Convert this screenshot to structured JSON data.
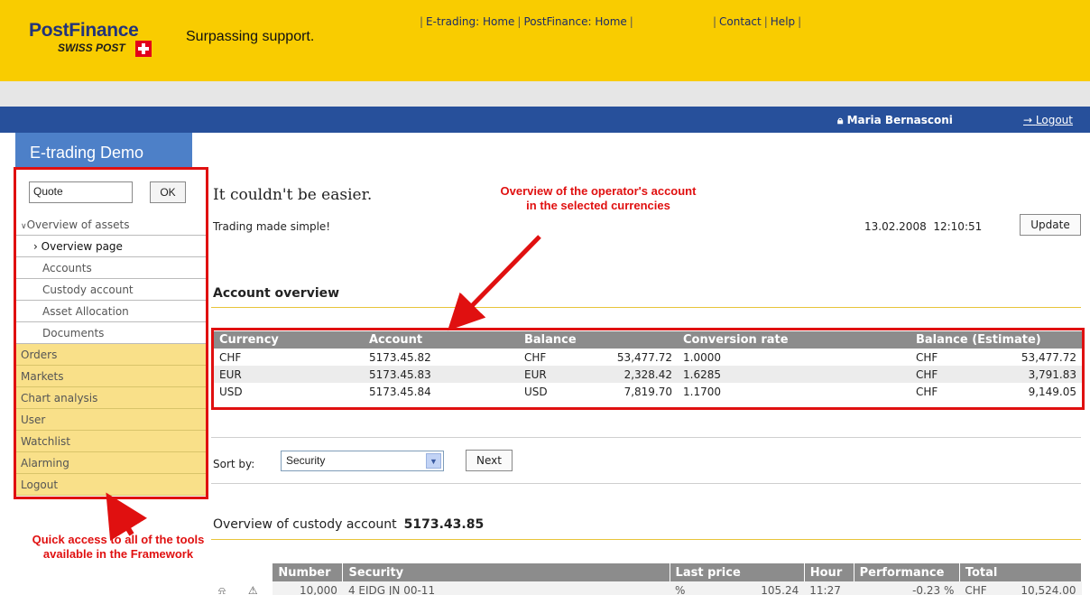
{
  "header": {
    "brand": "PostFinance",
    "brand_sub": "SWISS POST",
    "tagline": "Surpassing support.",
    "links": [
      "E-trading: Home",
      "PostFinance: Home",
      "Contact",
      "Help"
    ]
  },
  "userbar": {
    "user": "Maria Bernasconi",
    "logout": "Logout"
  },
  "sidebar": {
    "title": "E-trading Demo",
    "quote_value": "Quote",
    "ok_label": "OK",
    "items": [
      {
        "label": "Overview of assets"
      },
      {
        "label": "Overview page"
      },
      {
        "label": "Accounts"
      },
      {
        "label": "Custody account"
      },
      {
        "label": "Asset Allocation"
      },
      {
        "label": "Documents"
      },
      {
        "label": "Orders"
      },
      {
        "label": "Markets"
      },
      {
        "label": "Chart analysis"
      },
      {
        "label": "User"
      },
      {
        "label": "Watchlist"
      },
      {
        "label": "Alarming"
      },
      {
        "label": "Logout"
      }
    ]
  },
  "main": {
    "headline": "It couldn't be easier.",
    "subline": "Trading made simple!",
    "date": "13.02.2008",
    "time": "12:10:51",
    "update_label": "Update",
    "account_overview_title": "Account overview",
    "account_table": {
      "headers": [
        "Currency",
        "Account",
        "Balance",
        "Conversion rate",
        "Balance (Estimate)"
      ],
      "rows": [
        {
          "currency": "CHF",
          "account": "5173.45.82",
          "bal_cur": "CHF",
          "balance": "53,477.72",
          "rate": "1.0000",
          "est_cur": "CHF",
          "estimate": "53,477.72"
        },
        {
          "currency": "EUR",
          "account": "5173.45.83",
          "bal_cur": "EUR",
          "balance": "2,328.42",
          "rate": "1.6285",
          "est_cur": "CHF",
          "estimate": "3,791.83"
        },
        {
          "currency": "USD",
          "account": "5173.45.84",
          "bal_cur": "USD",
          "balance": "7,819.70",
          "rate": "1.1700",
          "est_cur": "CHF",
          "estimate": "9,149.05"
        }
      ]
    },
    "sort_label": "Sort by:",
    "sort_value": "Security",
    "next_label": "Next",
    "custody_title": "Overview of custody account",
    "custody_number": "5173.43.85",
    "custody_table": {
      "headers": [
        "Number",
        "Security",
        "Last price",
        "Hour",
        "Performance",
        "Total"
      ],
      "row": {
        "number": "10,000",
        "security": "4 EIDG JN 00-11",
        "price_unit": "%",
        "price": "105.24",
        "hour": "11:27",
        "performance": "-0.23 %",
        "total_cur": "CHF",
        "total": "10,524.00"
      }
    }
  },
  "annotations": {
    "top": "Overview of the operator's account in the selected currencies",
    "bottom": "Quick access to all of the tools available in the Framework"
  },
  "colors": {
    "header_yellow": "#f9cc00",
    "nav_blue": "#27509b",
    "sidebar_title_blue": "#4d80c8",
    "annotation_red": "#e01010"
  }
}
